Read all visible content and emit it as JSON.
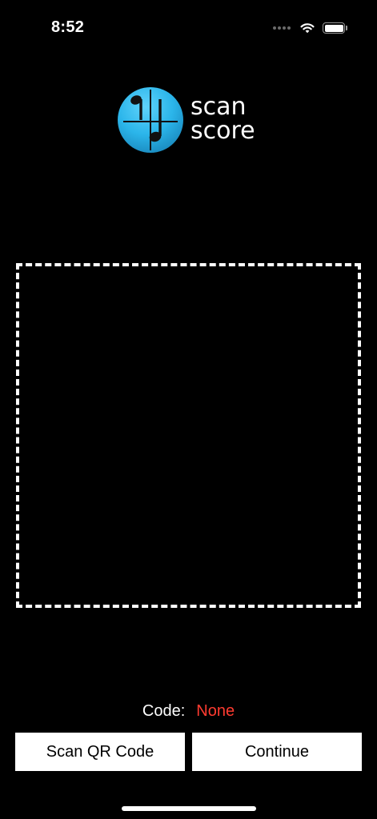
{
  "status_bar": {
    "time": "8:52",
    "icons": [
      "cellular-signal-icon",
      "wifi-icon",
      "battery-icon"
    ],
    "battery_level": 1.0
  },
  "logo": {
    "icon": "music-note-icon",
    "line1": "scan",
    "line2": "score",
    "brand_color": "#2BB5EA"
  },
  "scanner": {
    "frame_style": "dashed",
    "frame_color": "#FFFFFF"
  },
  "code": {
    "label": "Code:",
    "value": "None",
    "value_color": "#FF3B30"
  },
  "buttons": {
    "scan_label": "Scan QR Code",
    "continue_label": "Continue"
  }
}
